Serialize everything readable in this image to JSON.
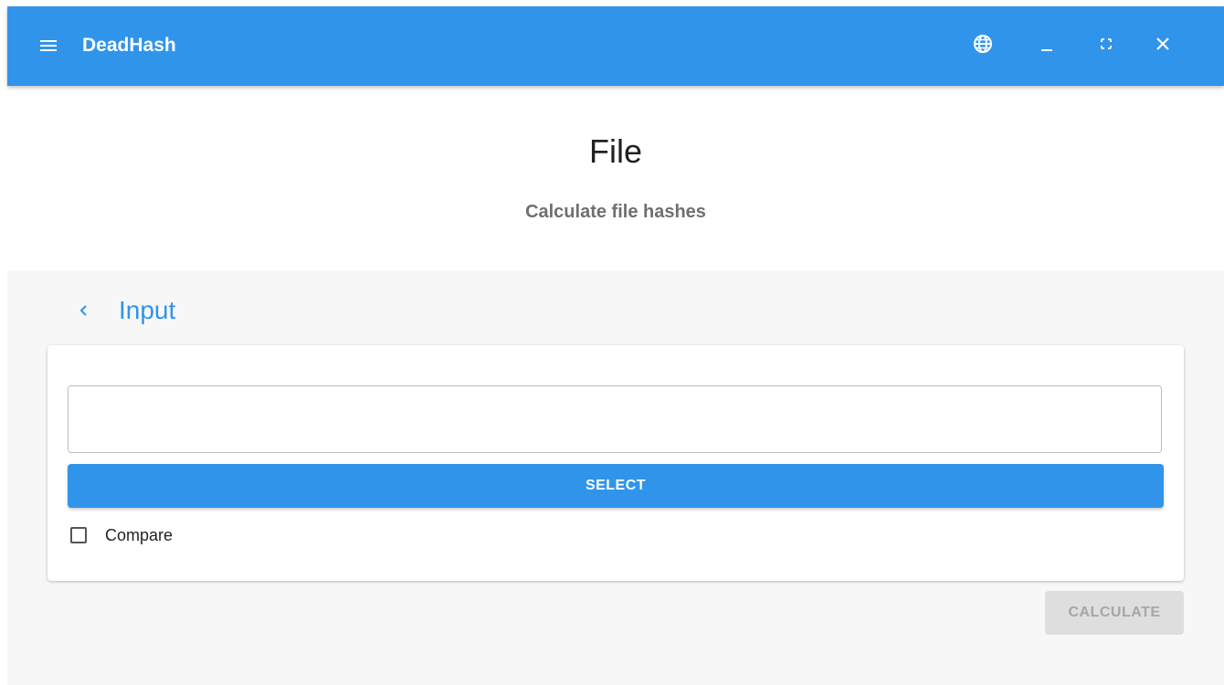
{
  "appbar": {
    "title": "DeadHash",
    "icons": {
      "menu": "menu-icon",
      "language": "globe-icon",
      "minimize": "minimize-icon",
      "maximize": "fullscreen-icon",
      "close": "close-icon"
    }
  },
  "page": {
    "title": "File",
    "subtitle": "Calculate file hashes"
  },
  "section": {
    "title": "Input",
    "back_icon": "chevron-left-icon"
  },
  "form": {
    "file_value": "",
    "select_label": "SELECT",
    "compare_label": "Compare",
    "compare_checked": false,
    "calculate_label": "CALCULATE",
    "calculate_disabled": true
  },
  "colors": {
    "primary": "#3094eb",
    "background": "#f7f7f7",
    "disabled_bg": "#dedede",
    "disabled_text": "#a6a6a6"
  }
}
